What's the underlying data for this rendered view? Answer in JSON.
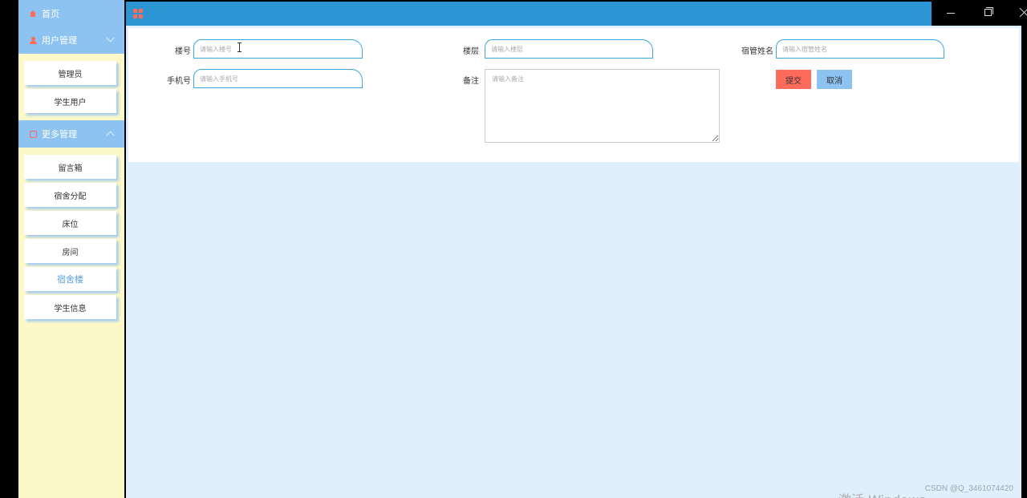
{
  "sidebar": {
    "home": "首页",
    "groups": [
      {
        "label": "用户管理",
        "items": [
          "管理员",
          "学生用户"
        ]
      },
      {
        "label": "更多管理",
        "items": [
          "留言箱",
          "宿舍分配",
          "床位",
          "房间",
          "宿舍楼",
          "学生信息"
        ]
      }
    ],
    "active_item": "宿舍楼"
  },
  "form": {
    "building_no": {
      "label": "楼号",
      "placeholder": "请输入楼号"
    },
    "floor": {
      "label": "楼层",
      "placeholder": "请输入楼层"
    },
    "manager_name": {
      "label": "宿管姓名",
      "placeholder": "请输入宿管姓名"
    },
    "phone": {
      "label": "手机号",
      "placeholder": "请输入手机号"
    },
    "note": {
      "label": "备注",
      "placeholder": "请输入备注"
    },
    "submit_label": "提交",
    "cancel_label": "取消"
  },
  "watermark": "CSDN @Q_3461074420",
  "windows_activation": "激活 Windows",
  "colors": {
    "accent": "#2c95d4",
    "sidebar_header": "#8cc3f0",
    "sidebar_bg": "#fdf8c8",
    "submit": "#ff6b5a",
    "main_bg": "#e0effc"
  }
}
